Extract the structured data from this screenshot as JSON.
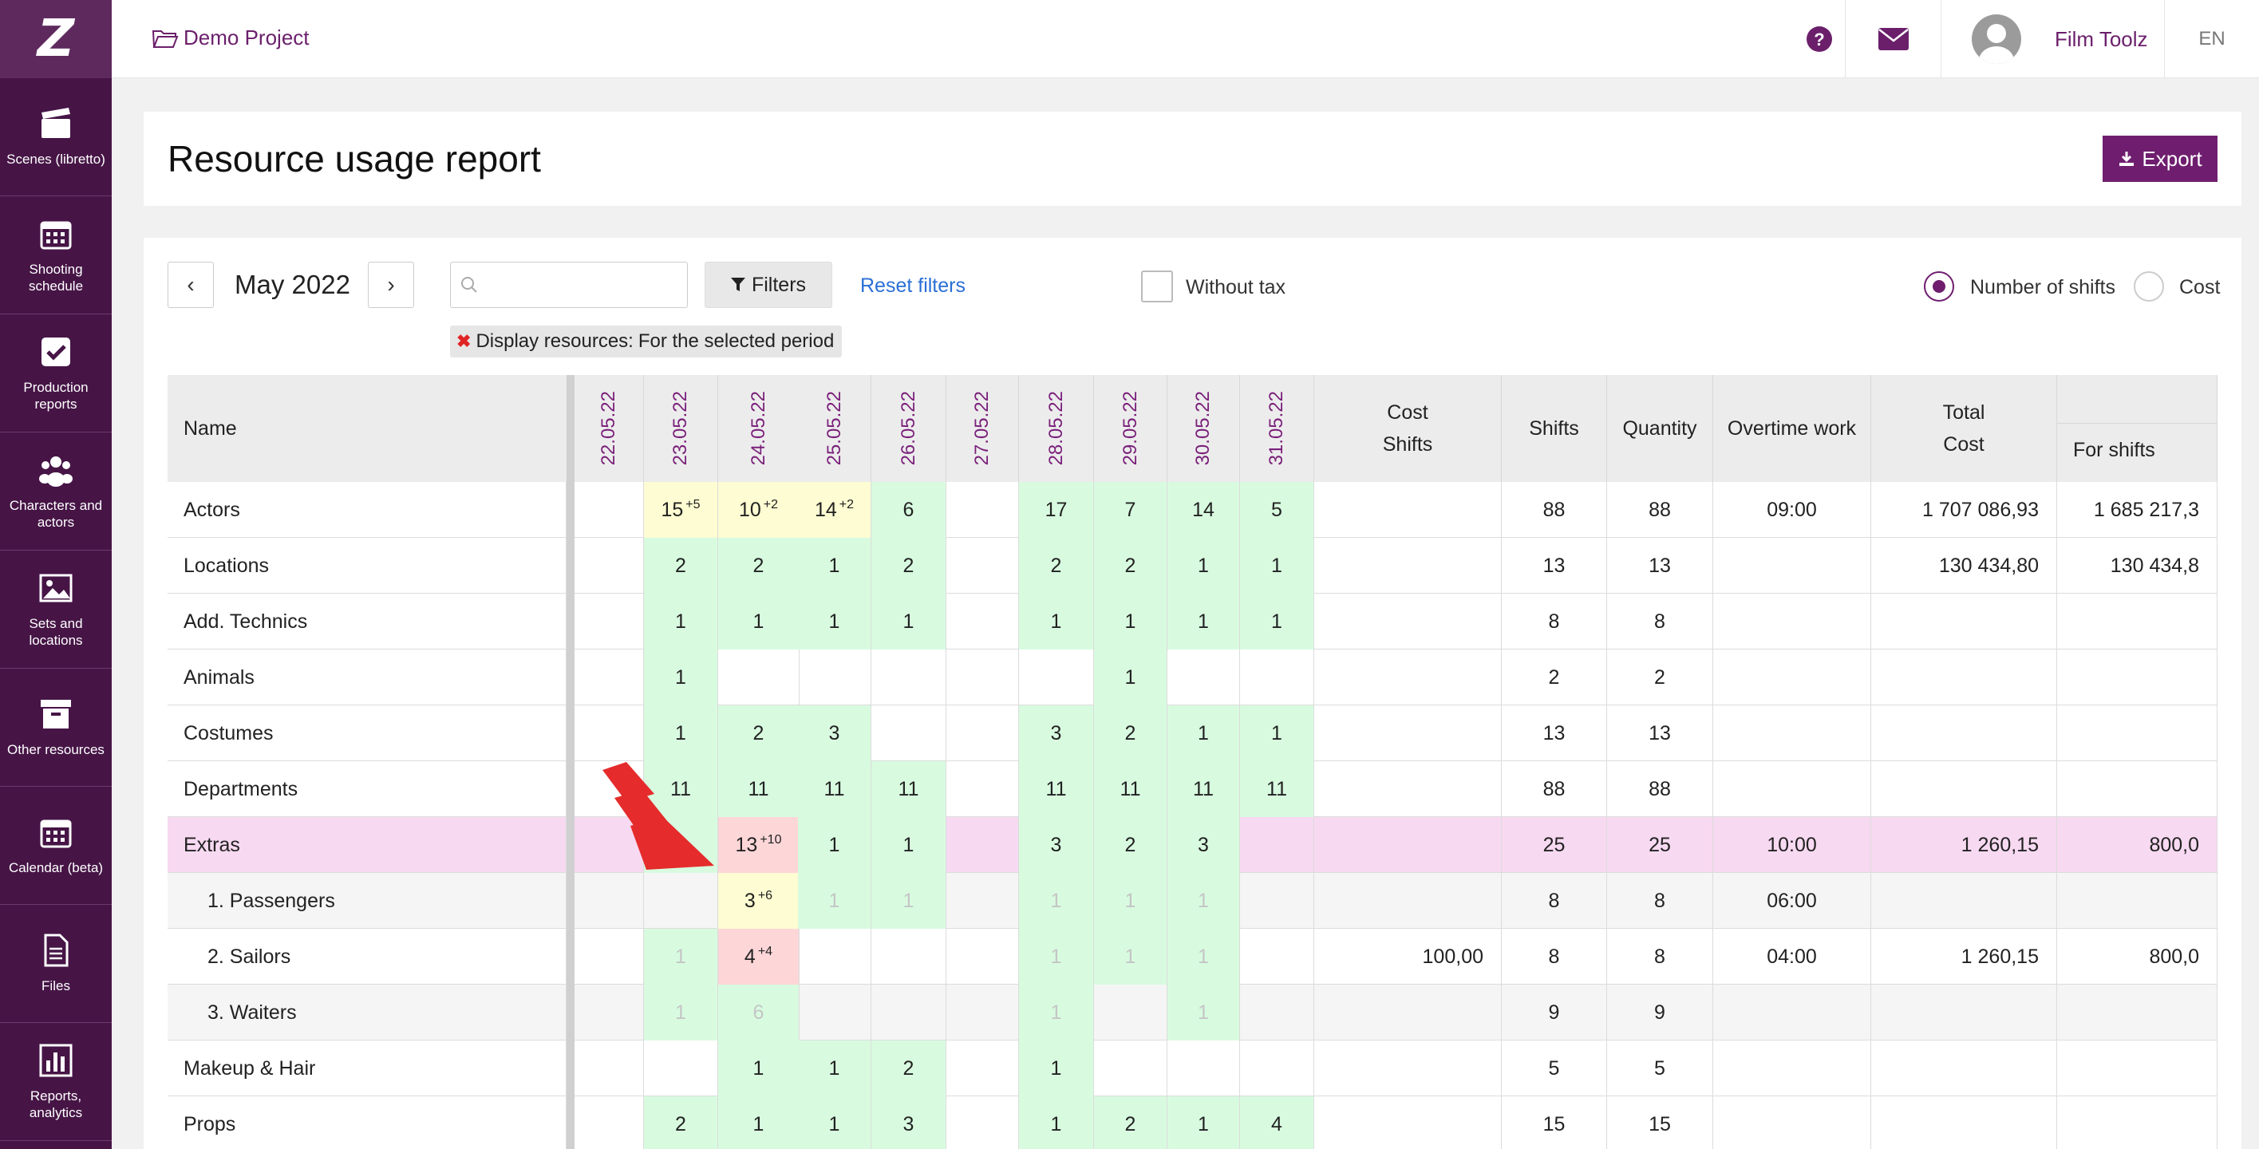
{
  "sidebar": {
    "logo": "Z",
    "items": [
      {
        "label": "Scenes (libretto)",
        "icon": "clapperboard-icon"
      },
      {
        "label": "Shooting schedule",
        "icon": "calendar-icon"
      },
      {
        "label": "Production reports",
        "icon": "checkbox-icon"
      },
      {
        "label": "Characters and actors",
        "icon": "users-icon"
      },
      {
        "label": "Sets and locations",
        "icon": "image-icon"
      },
      {
        "label": "Other resources",
        "icon": "archive-icon"
      },
      {
        "label": "Calendar (beta)",
        "icon": "calendar-icon"
      },
      {
        "label": "Files",
        "icon": "file-icon"
      },
      {
        "label": "Reports, analytics",
        "icon": "chart-icon"
      }
    ]
  },
  "topbar": {
    "project": "Demo Project",
    "user": "Film Toolz",
    "lang": "EN"
  },
  "header": {
    "title": "Resource usage report",
    "export": "Export"
  },
  "controls": {
    "prev": "‹",
    "next": "›",
    "month": "May 2022",
    "search_value": "",
    "filters": "Filters",
    "reset": "Reset filters",
    "without_tax": "Without tax",
    "radio1": "Number of shifts",
    "radio2": "Cost",
    "chip_label": "Display resources:",
    "chip_value": "For the selected period"
  },
  "colors": {
    "accent": "#6f1e6f",
    "green": "#d8fbe0",
    "yellow": "#fdfcd2",
    "pink": "#fdd6d8",
    "extras": "#f7d9f1"
  },
  "table": {
    "headers": {
      "name": "Name",
      "cost1": "Cost",
      "cost2": "Shifts",
      "shifts": "Shifts",
      "quantity": "Quantity",
      "overtime": "Overtime work",
      "total1": "Total",
      "total2": "Cost",
      "forshifts": "For shifts"
    },
    "dates": [
      "22.05.22",
      "23.05.22",
      "24.05.22",
      "25.05.22",
      "26.05.22",
      "27.05.22",
      "28.05.22",
      "29.05.22",
      "30.05.22",
      "31.05.22"
    ],
    "rows": [
      {
        "name": "Actors",
        "days": [
          "",
          "15",
          "10",
          "14",
          "6",
          "",
          "17",
          "7",
          "14",
          "5"
        ],
        "sup": [
          "",
          "+5",
          "+2",
          "+2",
          "",
          "",
          "",
          "",
          "",
          ""
        ],
        "bg": [
          "",
          "y",
          "y",
          "y",
          "g",
          "",
          "g",
          "g",
          "g",
          "g"
        ],
        "cost": "",
        "shifts": "88",
        "qty": "88",
        "over": "09:00",
        "total": "1 707 086,93",
        "forshifts": "1 685 217,3"
      },
      {
        "name": "Locations",
        "days": [
          "",
          "2",
          "2",
          "1",
          "2",
          "",
          "2",
          "2",
          "1",
          "1"
        ],
        "sup": [
          "",
          "",
          "",
          "",
          "",
          "",
          "",
          "",
          "",
          ""
        ],
        "bg": [
          "",
          "g",
          "g",
          "g",
          "g",
          "",
          "g",
          "g",
          "g",
          "g"
        ],
        "cost": "",
        "shifts": "13",
        "qty": "13",
        "over": "",
        "total": "130 434,80",
        "forshifts": "130 434,8"
      },
      {
        "name": "Add. Technics",
        "days": [
          "",
          "1",
          "1",
          "1",
          "1",
          "",
          "1",
          "1",
          "1",
          "1"
        ],
        "sup": [
          "",
          "",
          "",
          "",
          "",
          "",
          "",
          "",
          "",
          ""
        ],
        "bg": [
          "",
          "g",
          "g",
          "g",
          "g",
          "",
          "g",
          "g",
          "g",
          "g"
        ],
        "cost": "",
        "shifts": "8",
        "qty": "8",
        "over": "",
        "total": "",
        "forshifts": ""
      },
      {
        "name": "Animals",
        "days": [
          "",
          "1",
          "",
          "",
          "",
          "",
          "",
          "1",
          "",
          ""
        ],
        "sup": [
          "",
          "",
          "",
          "",
          "",
          "",
          "",
          "",
          "",
          ""
        ],
        "bg": [
          "",
          "g",
          "",
          "",
          "",
          "",
          "",
          "g",
          "",
          ""
        ],
        "cost": "",
        "shifts": "2",
        "qty": "2",
        "over": "",
        "total": "",
        "forshifts": ""
      },
      {
        "name": "Costumes",
        "days": [
          "",
          "1",
          "2",
          "3",
          "",
          "",
          "3",
          "2",
          "1",
          "1"
        ],
        "sup": [
          "",
          "",
          "",
          "",
          "",
          "",
          "",
          "",
          "",
          ""
        ],
        "bg": [
          "",
          "g",
          "g",
          "g",
          "",
          "",
          "g",
          "g",
          "g",
          "g"
        ],
        "cost": "",
        "shifts": "13",
        "qty": "13",
        "over": "",
        "total": "",
        "forshifts": ""
      },
      {
        "name": "Departments",
        "days": [
          "",
          "11",
          "11",
          "11",
          "11",
          "",
          "11",
          "11",
          "11",
          "11"
        ],
        "sup": [
          "",
          "",
          "",
          "",
          "",
          "",
          "",
          "",
          "",
          ""
        ],
        "bg": [
          "",
          "g",
          "g",
          "g",
          "g",
          "",
          "g",
          "g",
          "g",
          "g"
        ],
        "cost": "",
        "shifts": "88",
        "qty": "88",
        "over": "",
        "total": "",
        "forshifts": ""
      },
      {
        "name": "Extras",
        "days": [
          "",
          "",
          "13",
          "1",
          "1",
          "",
          "3",
          "2",
          "3",
          ""
        ],
        "sup": [
          "",
          "",
          "+10",
          "",
          "",
          "",
          "",
          "",
          "",
          ""
        ],
        "bg": [
          "",
          "g",
          "p",
          "g",
          "g",
          "",
          "g",
          "g",
          "g",
          ""
        ],
        "cost": "",
        "shifts": "25",
        "qty": "25",
        "over": "10:00",
        "total": "1 260,15",
        "forshifts": "800,0",
        "rowbg": "extras"
      },
      {
        "name": "1. Passengers",
        "days": [
          "",
          "",
          "3",
          "1",
          "1",
          "",
          "1",
          "1",
          "1",
          ""
        ],
        "sup": [
          "",
          "",
          "+6",
          "",
          "",
          "",
          "",
          "",
          "",
          ""
        ],
        "bg": [
          "",
          "",
          "y",
          "gf",
          "gf",
          "",
          "gf",
          "gf",
          "gf",
          ""
        ],
        "cost": "",
        "shifts": "8",
        "qty": "8",
        "over": "06:00",
        "total": "",
        "forshifts": "",
        "rowbg": "grey",
        "indent": true
      },
      {
        "name": "2. Sailors",
        "days": [
          "",
          "1",
          "4",
          "",
          "",
          "",
          "1",
          "1",
          "1",
          ""
        ],
        "sup": [
          "",
          "",
          "+4",
          "",
          "",
          "",
          "",
          "",
          "",
          ""
        ],
        "bg": [
          "",
          "gf",
          "p",
          "",
          "",
          "",
          "gf",
          "gf",
          "gf",
          ""
        ],
        "cost": "100,00",
        "shifts": "8",
        "qty": "8",
        "over": "04:00",
        "total": "1 260,15",
        "forshifts": "800,0",
        "indent": true
      },
      {
        "name": "3. Waiters",
        "days": [
          "",
          "1",
          "6",
          "",
          "",
          "",
          "1",
          "",
          "1",
          ""
        ],
        "sup": [
          "",
          "",
          "",
          "",
          "",
          "",
          "",
          "",
          "",
          ""
        ],
        "bg": [
          "",
          "gf",
          "gf",
          "",
          "",
          "",
          "gf",
          "",
          "gf",
          ""
        ],
        "cost": "",
        "shifts": "9",
        "qty": "9",
        "over": "",
        "total": "",
        "forshifts": "",
        "rowbg": "grey",
        "indent": true
      },
      {
        "name": "Makeup & Hair",
        "days": [
          "",
          "",
          "1",
          "1",
          "2",
          "",
          "1",
          "",
          "",
          ""
        ],
        "sup": [
          "",
          "",
          "",
          "",
          "",
          "",
          "",
          "",
          "",
          ""
        ],
        "bg": [
          "",
          "",
          "g",
          "g",
          "g",
          "",
          "g",
          "",
          "",
          ""
        ],
        "cost": "",
        "shifts": "5",
        "qty": "5",
        "over": "",
        "total": "",
        "forshifts": ""
      },
      {
        "name": "Props",
        "days": [
          "",
          "2",
          "1",
          "1",
          "3",
          "",
          "1",
          "2",
          "1",
          "4"
        ],
        "sup": [
          "",
          "",
          "",
          "",
          "",
          "",
          "",
          "",
          "",
          ""
        ],
        "bg": [
          "",
          "g",
          "g",
          "g",
          "g",
          "",
          "g",
          "g",
          "g",
          "g"
        ],
        "cost": "",
        "shifts": "15",
        "qty": "15",
        "over": "",
        "total": "",
        "forshifts": ""
      }
    ]
  }
}
